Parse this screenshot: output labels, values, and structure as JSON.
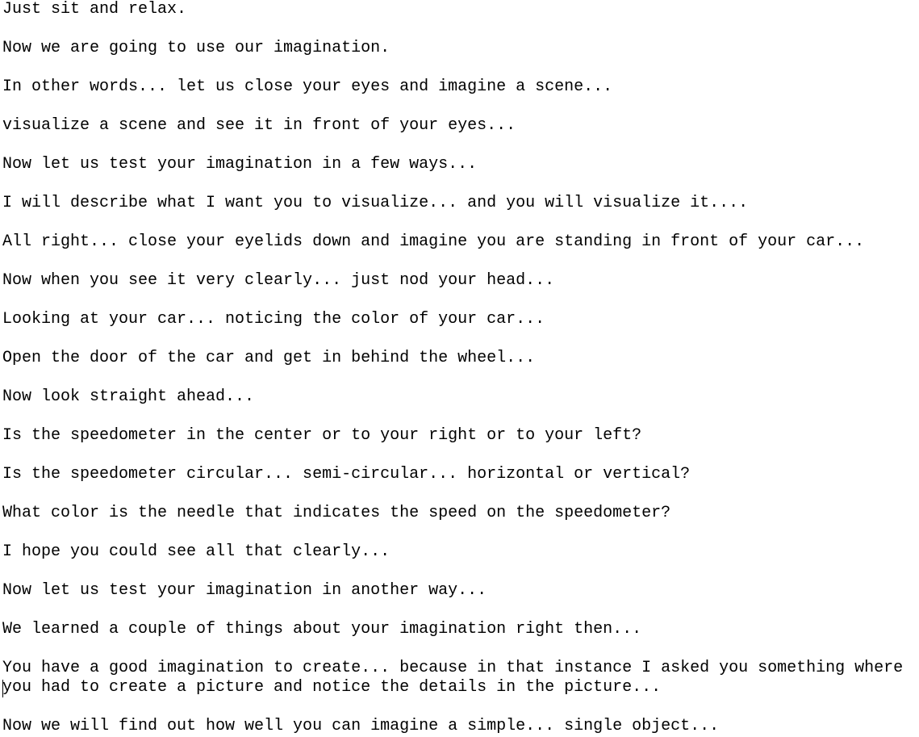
{
  "document": {
    "lines": [
      "Just sit and relax.",
      "Now we are going to use our imagination.",
      "In other words... let us close your eyes and imagine a scene...",
      "visualize a scene and see it in front of your eyes...",
      "Now let us test your imagination in a few ways...",
      "I will describe what I want you to visualize... and you will visualize it....",
      "All right... close your eyelids down and imagine you are standing in front of your car...",
      "Now when you see it very clearly... just nod your head...",
      "Looking at your car... noticing the color of your car...",
      "Open the door of the car and get in behind the wheel...",
      "Now look straight ahead...",
      "Is the speedometer in the center or to your right or to your left?",
      "Is the speedometer circular... semi-circular... horizontal or vertical?",
      "What color is the needle that indicates the speed on the speedometer?",
      "I hope you could see all that clearly...",
      "Now let us test your imagination in another way...",
      "We learned a couple of things about your imagination right then...",
      "You have a good imagination to create... because in that instance I asked you something where",
      "you had to create a picture and notice the details in the picture...",
      "Now we will find out how well you can imagine a simple... single object..."
    ]
  }
}
